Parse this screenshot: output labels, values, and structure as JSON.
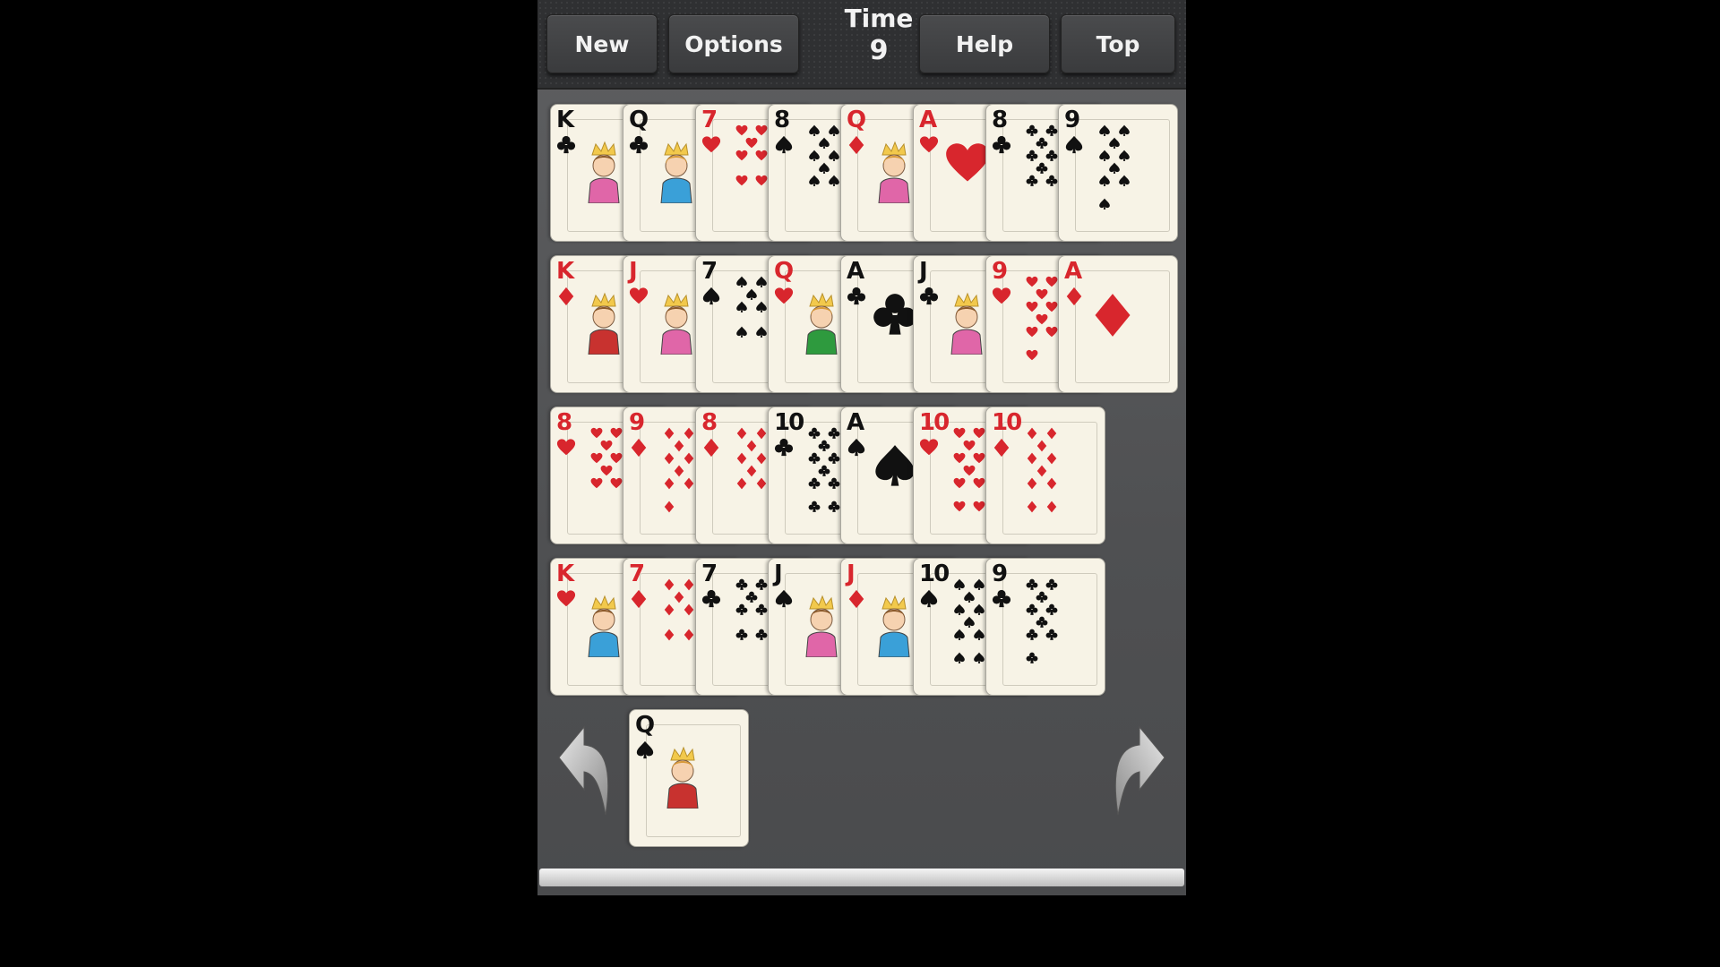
{
  "toolbar": {
    "new_label": "New",
    "options_label": "Options",
    "help_label": "Help",
    "top_label": "Top",
    "time_label": "Time",
    "time_value": "9"
  },
  "colors": {
    "red": "#d8262d",
    "black": "#111111",
    "card_bg": "#f7f3e6"
  },
  "tableau": [
    [
      {
        "rank": "K",
        "suit": "clubs"
      },
      {
        "rank": "Q",
        "suit": "clubs"
      },
      {
        "rank": "7",
        "suit": "hearts"
      },
      {
        "rank": "8",
        "suit": "spades"
      },
      {
        "rank": "Q",
        "suit": "diamonds"
      },
      {
        "rank": "A",
        "suit": "hearts"
      },
      {
        "rank": "8",
        "suit": "clubs"
      },
      {
        "rank": "9",
        "suit": "spades"
      }
    ],
    [
      {
        "rank": "K",
        "suit": "diamonds"
      },
      {
        "rank": "J",
        "suit": "hearts"
      },
      {
        "rank": "7",
        "suit": "spades"
      },
      {
        "rank": "Q",
        "suit": "hearts"
      },
      {
        "rank": "A",
        "suit": "clubs"
      },
      {
        "rank": "J",
        "suit": "clubs"
      },
      {
        "rank": "9",
        "suit": "hearts"
      },
      {
        "rank": "A",
        "suit": "diamonds"
      }
    ],
    [
      {
        "rank": "8",
        "suit": "hearts"
      },
      {
        "rank": "9",
        "suit": "diamonds"
      },
      {
        "rank": "8",
        "suit": "diamonds"
      },
      {
        "rank": "10",
        "suit": "clubs"
      },
      {
        "rank": "A",
        "suit": "spades"
      },
      {
        "rank": "10",
        "suit": "hearts"
      },
      {
        "rank": "10",
        "suit": "diamonds"
      }
    ],
    [
      {
        "rank": "K",
        "suit": "hearts"
      },
      {
        "rank": "7",
        "suit": "diamonds"
      },
      {
        "rank": "7",
        "suit": "clubs"
      },
      {
        "rank": "J",
        "suit": "spades"
      },
      {
        "rank": "J",
        "suit": "diamonds"
      },
      {
        "rank": "10",
        "suit": "spades"
      },
      {
        "rank": "9",
        "suit": "clubs"
      }
    ]
  ],
  "stock_card": {
    "rank": "Q",
    "suit": "spades"
  },
  "icons": {
    "undo": "undo-arrow-icon",
    "redo": "redo-arrow-icon"
  }
}
